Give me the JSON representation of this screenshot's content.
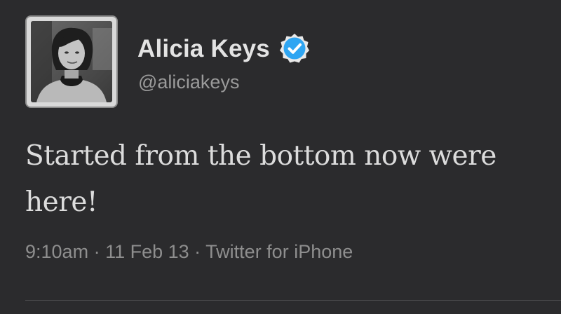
{
  "tweet": {
    "author": {
      "display_name": "Alicia Keys",
      "handle": "@aliciakeys",
      "verified": true,
      "verified_icon": "verified-badge-icon",
      "verified_color": "#2ea5f2",
      "avatar_icon": "profile-photo"
    },
    "text": "Started from the bottom now were here!",
    "meta": {
      "time": "9:10am",
      "separator": " · ",
      "date": "11 Feb 13",
      "source": "Twitter for iPhone"
    }
  },
  "colors": {
    "background": "#2b2b2d",
    "name_text": "#e3e3e3",
    "body_text": "#dcdcdc",
    "secondary_text": "#8e8e8e"
  }
}
